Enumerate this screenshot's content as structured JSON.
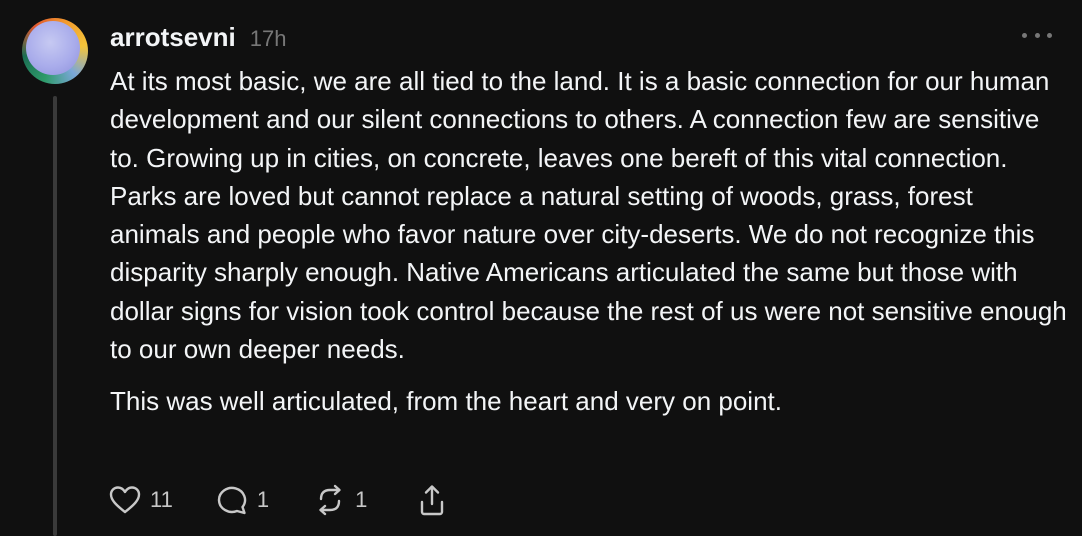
{
  "post": {
    "username": "arrotsevni",
    "timestamp": "17h",
    "paragraphs": [
      "At its most basic, we are all tied to the land. It is a basic connection for our human development and our silent connections to others. A connection few are sensitive to. Growing up in cities, on concrete, leaves one bereft of this vital connection. Parks are loved but cannot replace a natural setting of woods, grass, forest animals and people who favor nature over city-deserts. We do not recognize this disparity sharply enough. Native Americans articulated the same but those with dollar signs for vision took control because the rest of us were not sensitive enough to our own deeper needs.",
      "This was well articulated, from the heart and very on point."
    ]
  },
  "actions": {
    "like_count": "11",
    "reply_count": "1",
    "repost_count": "1"
  },
  "icons": {
    "like": "heart-icon",
    "reply": "speech-bubble-icon",
    "repost": "repost-arrows-icon",
    "share": "share-icon",
    "more": "more-dots-icon"
  },
  "colors": {
    "background": "#101010",
    "text_primary": "#f3f5f7",
    "text_secondary": "#777777",
    "icon": "#c8c8c8",
    "thread_line": "#3a3a3a"
  }
}
